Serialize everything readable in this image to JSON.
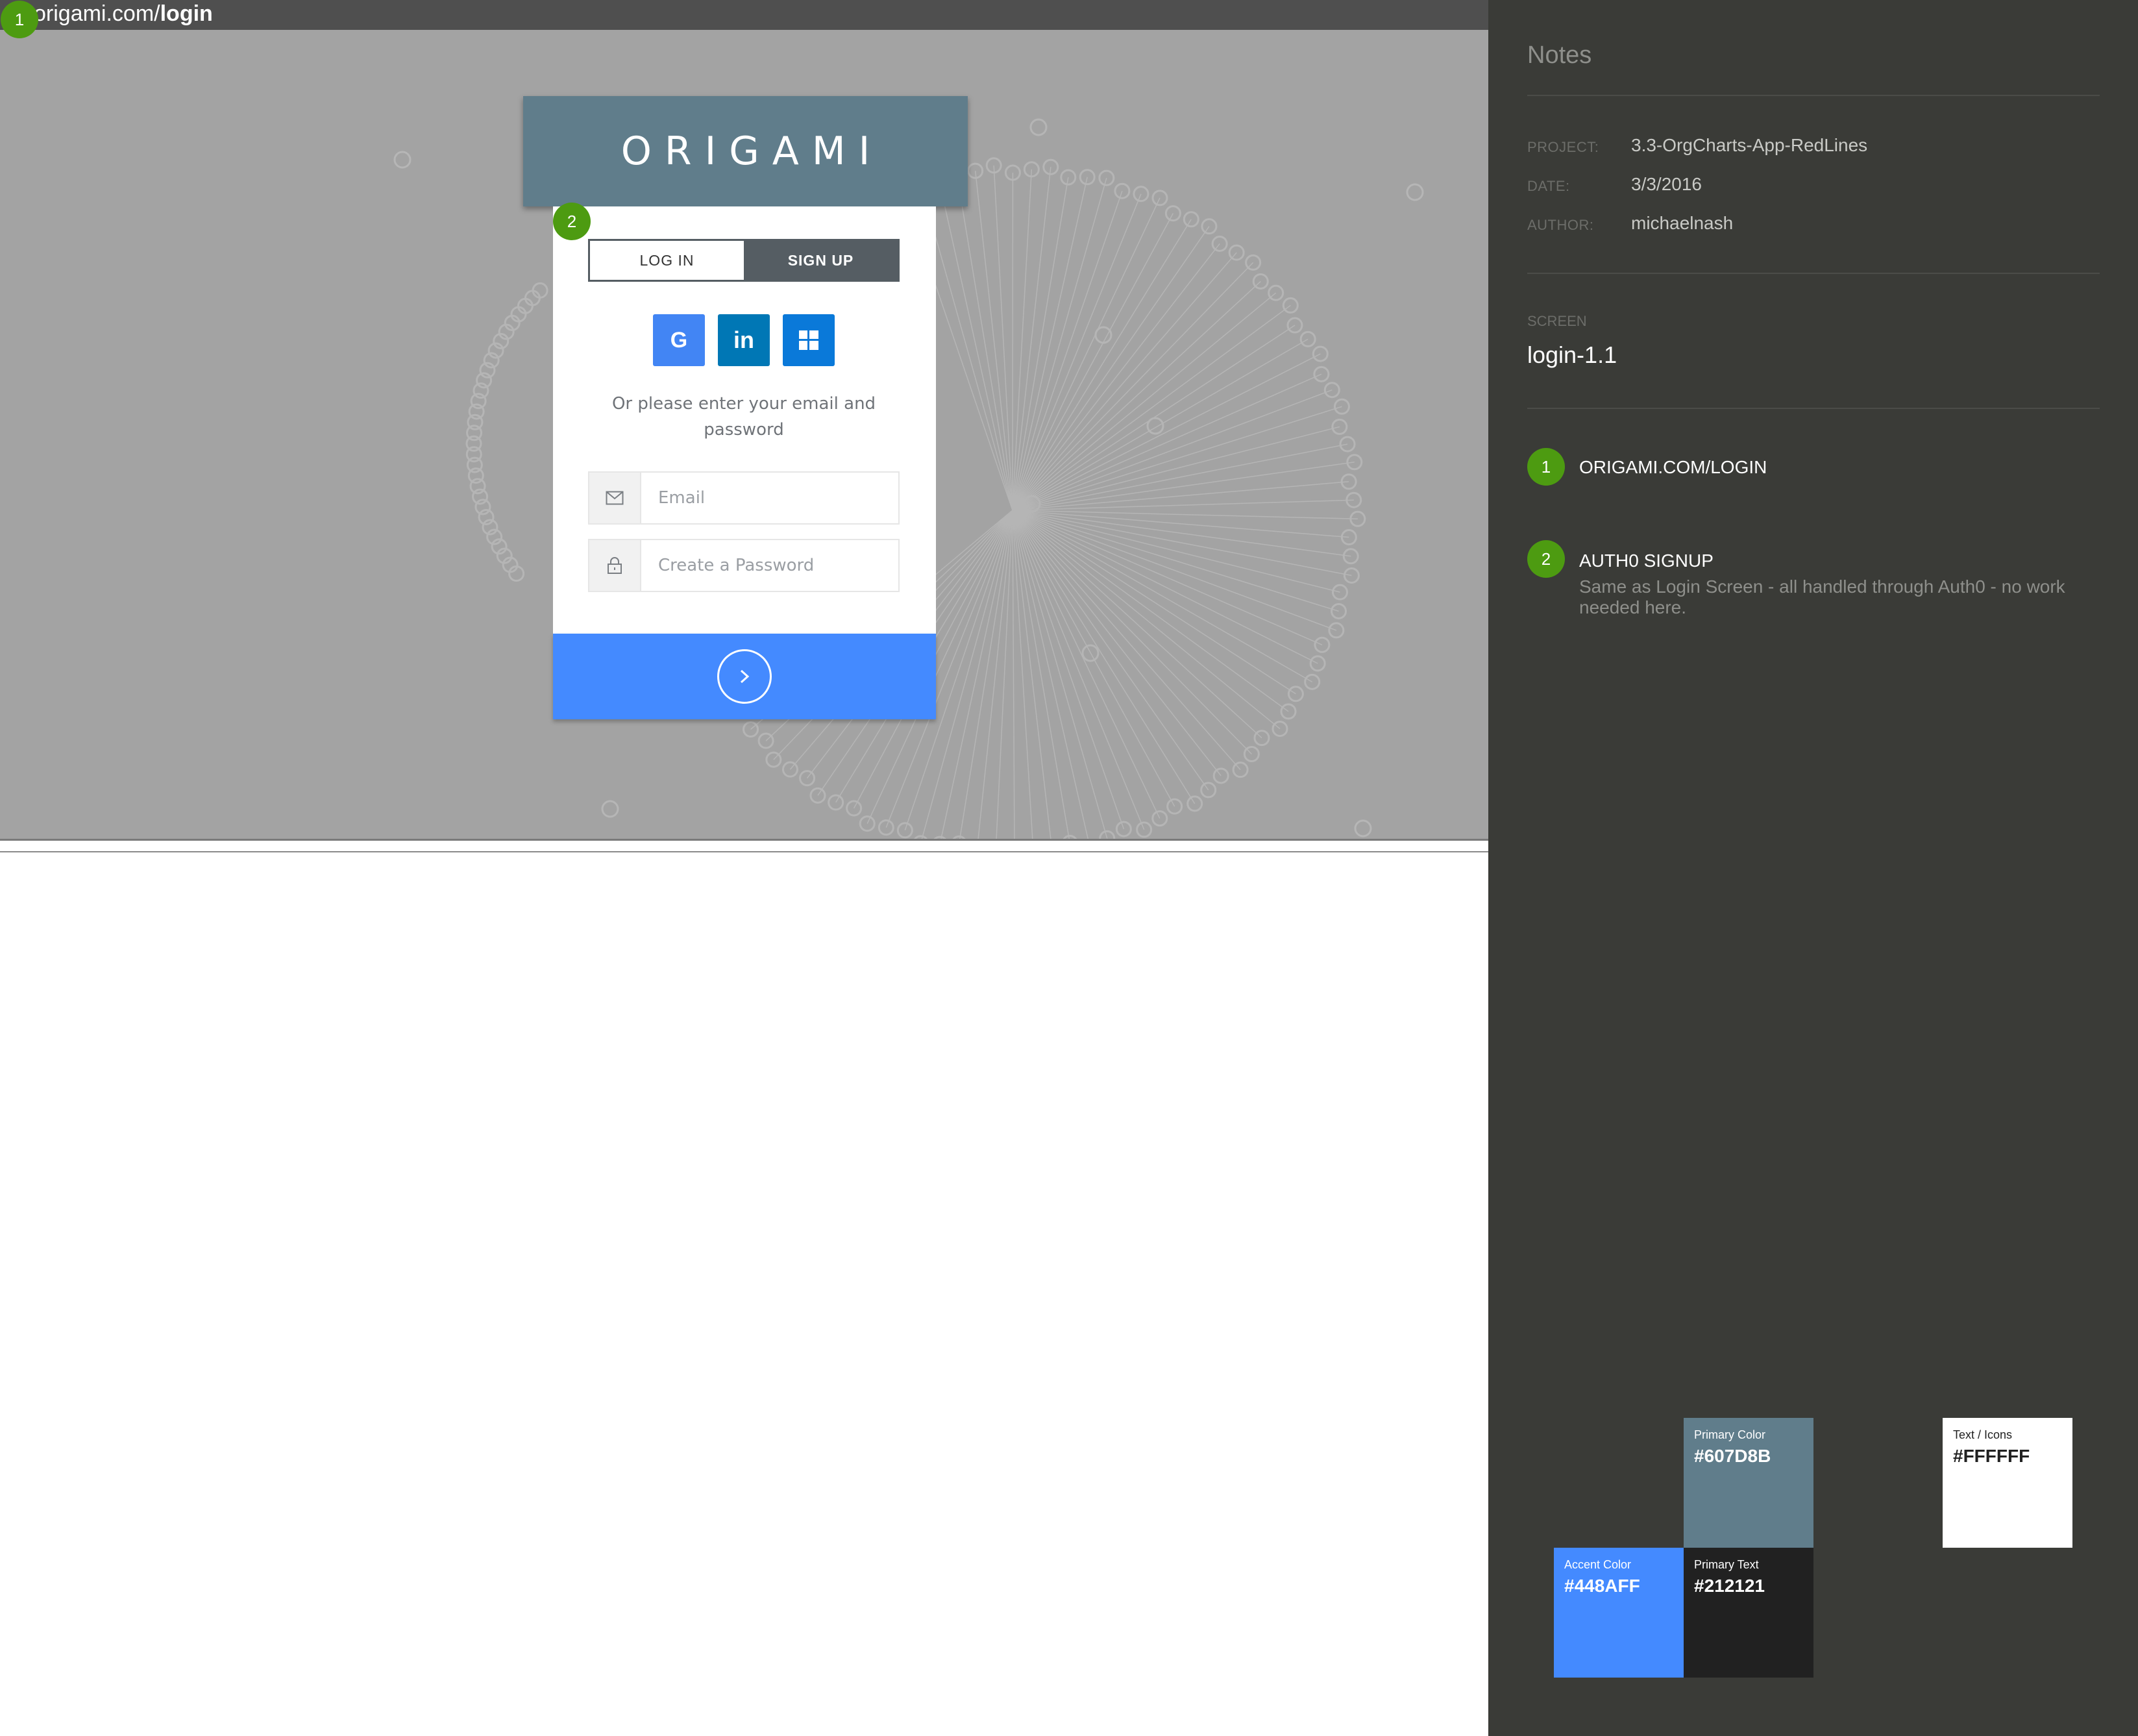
{
  "browser": {
    "url_prefix": "origami.com/",
    "url_path": "login"
  },
  "markers": {
    "url": "1",
    "auth": "2"
  },
  "card": {
    "brand": "ORIGAMI",
    "tabs": {
      "login": "LOG IN",
      "signup": "SIGN UP"
    },
    "social_icons": [
      "google-icon",
      "linkedin-icon",
      "windows-icon"
    ],
    "hint": "Or please enter your email and password",
    "email_placeholder": "Email",
    "password_placeholder": "Create a Password"
  },
  "notes": {
    "title": "Notes",
    "project_label": "PROJECT:",
    "project_value": "3.3-OrgCharts-App-RedLines",
    "date_label": "DATE:",
    "date_value": "3/3/2016",
    "author_label": "AUTHOR:",
    "author_value": "michaelnash",
    "screen_label": "SCREEN",
    "screen_value": "login-1.1",
    "items": [
      {
        "number": "1",
        "title": "ORIGAMI.COM/LOGIN",
        "description": ""
      },
      {
        "number": "2",
        "title": "AUTH0 SIGNUP",
        "description": "Same as Login Screen - all handled through Auth0 - no work needed here."
      }
    ]
  },
  "swatches": {
    "primary": {
      "name": "Primary Color",
      "hex": "#607D8B"
    },
    "text_icons": {
      "name": "Text / Icons",
      "hex": "#FFFFFF"
    },
    "accent": {
      "name": "Accent Color",
      "hex": "#448AFF"
    },
    "primary_text": {
      "name": "Primary Text",
      "hex": "#212121"
    }
  }
}
